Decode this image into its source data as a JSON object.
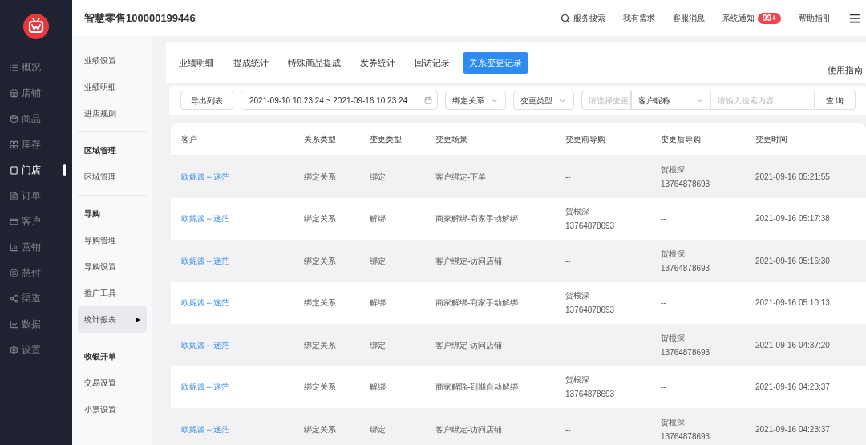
{
  "header": {
    "title": "智慧零售100000199446",
    "links": [
      {
        "kind": "search",
        "label": "服务搜索"
      },
      {
        "kind": "text",
        "label": "我有需求"
      },
      {
        "kind": "text",
        "label": "客服消息"
      },
      {
        "kind": "badge",
        "label": "系统通知",
        "badge": "99+"
      },
      {
        "kind": "text",
        "label": "帮助指引"
      }
    ]
  },
  "sidebar": {
    "items": [
      {
        "label": "概况",
        "selected": false
      },
      {
        "label": "店铺",
        "selected": false
      },
      {
        "label": "商品",
        "selected": false
      },
      {
        "label": "库存",
        "selected": false
      },
      {
        "label": "门店",
        "selected": true
      },
      {
        "label": "订单",
        "selected": false
      },
      {
        "label": "客户",
        "selected": false
      },
      {
        "label": "营销",
        "selected": false
      },
      {
        "label": "慧付",
        "selected": false
      },
      {
        "label": "渠道",
        "selected": false
      },
      {
        "label": "数据",
        "selected": false
      },
      {
        "label": "设置",
        "selected": false
      }
    ]
  },
  "submenu": {
    "groups": [
      {
        "items": [
          {
            "label": "业绩设置",
            "selected": false
          },
          {
            "label": "业绩明细",
            "selected": false
          },
          {
            "label": "进店规则",
            "selected": false
          }
        ]
      },
      {
        "title": "区域管理",
        "items": [
          {
            "label": "区域管理",
            "selected": false
          }
        ]
      },
      {
        "title": "导购",
        "items": [
          {
            "label": "导购管理",
            "selected": false
          },
          {
            "label": "导购设置",
            "selected": false
          },
          {
            "label": "推广工具",
            "selected": false
          },
          {
            "label": "统计报表",
            "selected": true,
            "arrow": "▶"
          }
        ]
      },
      {
        "title": "收银开单",
        "items": [
          {
            "label": "交易设置",
            "selected": false
          },
          {
            "label": "小票设置",
            "selected": false
          }
        ]
      }
    ]
  },
  "tabs": [
    {
      "label": "业绩明细",
      "selected": false
    },
    {
      "label": "提成统计",
      "selected": false
    },
    {
      "label": "特殊商品提成",
      "selected": false
    },
    {
      "label": "发券统计",
      "selected": false
    },
    {
      "label": "回访记录",
      "selected": false
    },
    {
      "label": "关系变更记录",
      "selected": true
    }
  ],
  "guide_link": "使用指南",
  "filters": {
    "export_button": "导出列表",
    "date_range": "2021-09-10 10:23:24 ~ 2021-09-16 10:23:24",
    "relation_select": "绑定关系",
    "change_type_select": "变更类型",
    "scene_placeholder": "请选择变更",
    "search_field_select": "客户昵称",
    "search_placeholder": "请输入搜索内容",
    "query_button": "查 询"
  },
  "table": {
    "columns": [
      "客户",
      "关系类型",
      "变更类型",
      "变更场景",
      "变更前导购",
      "变更后导购",
      "变更时间"
    ],
    "rows": [
      {
        "customer": "欧妮酱～迷茫",
        "relation": "绑定关系",
        "change_type": "绑定",
        "scene": "客户绑定-下单",
        "before": [
          "--"
        ],
        "after": [
          "贺根深",
          "13764878693"
        ],
        "time": "2021-09-16 05:21:55"
      },
      {
        "customer": "欧妮酱～迷茫",
        "relation": "绑定关系",
        "change_type": "解绑",
        "scene": "商家解绑-商家手动解绑",
        "before": [
          "贺根深",
          "13764878693"
        ],
        "after": [
          "--"
        ],
        "time": "2021-09-16 05:17:38"
      },
      {
        "customer": "欧妮酱～迷茫",
        "relation": "绑定关系",
        "change_type": "绑定",
        "scene": "客户绑定-访问店铺",
        "before": [
          "--"
        ],
        "after": [
          "贺根深",
          "13764878693"
        ],
        "time": "2021-09-16 05:16:30"
      },
      {
        "customer": "欧妮酱～迷茫",
        "relation": "绑定关系",
        "change_type": "解绑",
        "scene": "商家解绑-商家手动解绑",
        "before": [
          "贺根深",
          "13764878693"
        ],
        "after": [
          "--"
        ],
        "time": "2021-09-16 05:10:13"
      },
      {
        "customer": "欧妮酱～迷茫",
        "relation": "绑定关系",
        "change_type": "绑定",
        "scene": "客户绑定-访问店铺",
        "before": [
          "--"
        ],
        "after": [
          "贺根深",
          "13764878693"
        ],
        "time": "2021-09-16 04:37:20"
      },
      {
        "customer": "欧妮酱～迷茫",
        "relation": "绑定关系",
        "change_type": "解绑",
        "scene": "商家解除-到期自动解绑",
        "before": [
          "贺根深",
          "13764878693"
        ],
        "after": [
          "--"
        ],
        "time": "2021-09-16 04:23:37"
      },
      {
        "customer": "欧妮酱～迷茫",
        "relation": "绑定关系",
        "change_type": "绑定",
        "scene": "客户绑定-访问店铺",
        "before": [
          "--"
        ],
        "after": [
          "贺根深",
          "13764878693"
        ],
        "time": "2021-09-16 04:23:37"
      }
    ]
  }
}
